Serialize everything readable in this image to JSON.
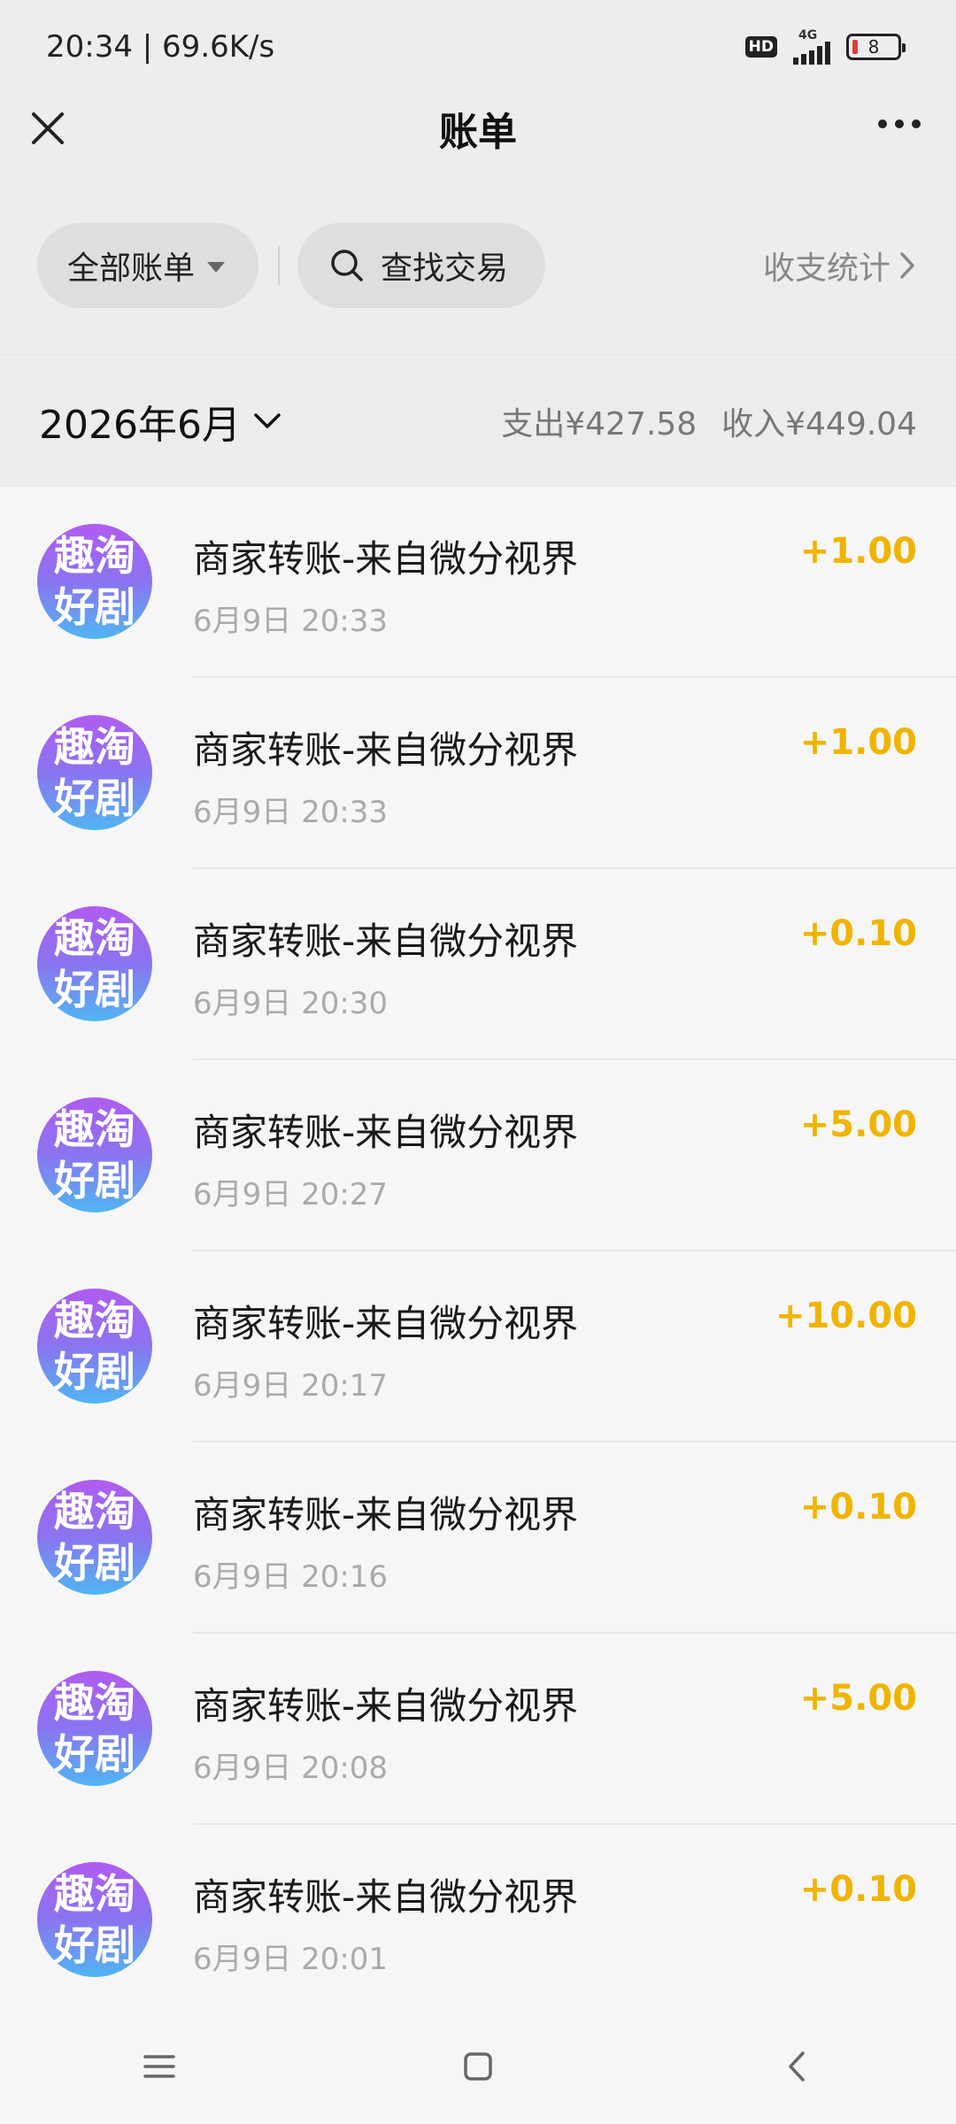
{
  "status_bar": {
    "time_speed": "20:34 | 69.6K/s",
    "hd": "HD",
    "network": "4G",
    "battery": "8"
  },
  "nav": {
    "title": "账单"
  },
  "filters": {
    "all_label": "全部账单",
    "search_label": "查找交易",
    "stats_label": "收支统计"
  },
  "month": {
    "label": "2026年6月",
    "expense": "支出¥427.58",
    "income": "收入¥449.04"
  },
  "transactions": [
    {
      "avatar_line1": "趣淘",
      "avatar_line2": "好剧",
      "title": "商家转账-来自微分视界",
      "time": "6月9日 20:33",
      "amount": "+1.00"
    },
    {
      "avatar_line1": "趣淘",
      "avatar_line2": "好剧",
      "title": "商家转账-来自微分视界",
      "time": "6月9日 20:33",
      "amount": "+1.00"
    },
    {
      "avatar_line1": "趣淘",
      "avatar_line2": "好剧",
      "title": "商家转账-来自微分视界",
      "time": "6月9日 20:30",
      "amount": "+0.10"
    },
    {
      "avatar_line1": "趣淘",
      "avatar_line2": "好剧",
      "title": "商家转账-来自微分视界",
      "time": "6月9日 20:27",
      "amount": "+5.00"
    },
    {
      "avatar_line1": "趣淘",
      "avatar_line2": "好剧",
      "title": "商家转账-来自微分视界",
      "time": "6月9日 20:17",
      "amount": "+10.00"
    },
    {
      "avatar_line1": "趣淘",
      "avatar_line2": "好剧",
      "title": "商家转账-来自微分视界",
      "time": "6月9日 20:16",
      "amount": "+0.10"
    },
    {
      "avatar_line1": "趣淘",
      "avatar_line2": "好剧",
      "title": "商家转账-来自微分视界",
      "time": "6月9日 20:08",
      "amount": "+5.00"
    },
    {
      "avatar_line1": "趣淘",
      "avatar_line2": "好剧",
      "title": "商家转账-来自微分视界",
      "time": "6月9日 20:01",
      "amount": "+0.10"
    }
  ],
  "colors": {
    "amount": "#f0b400",
    "avatar_top": "#b05cf0",
    "avatar_bottom": "#4fb5f2"
  }
}
